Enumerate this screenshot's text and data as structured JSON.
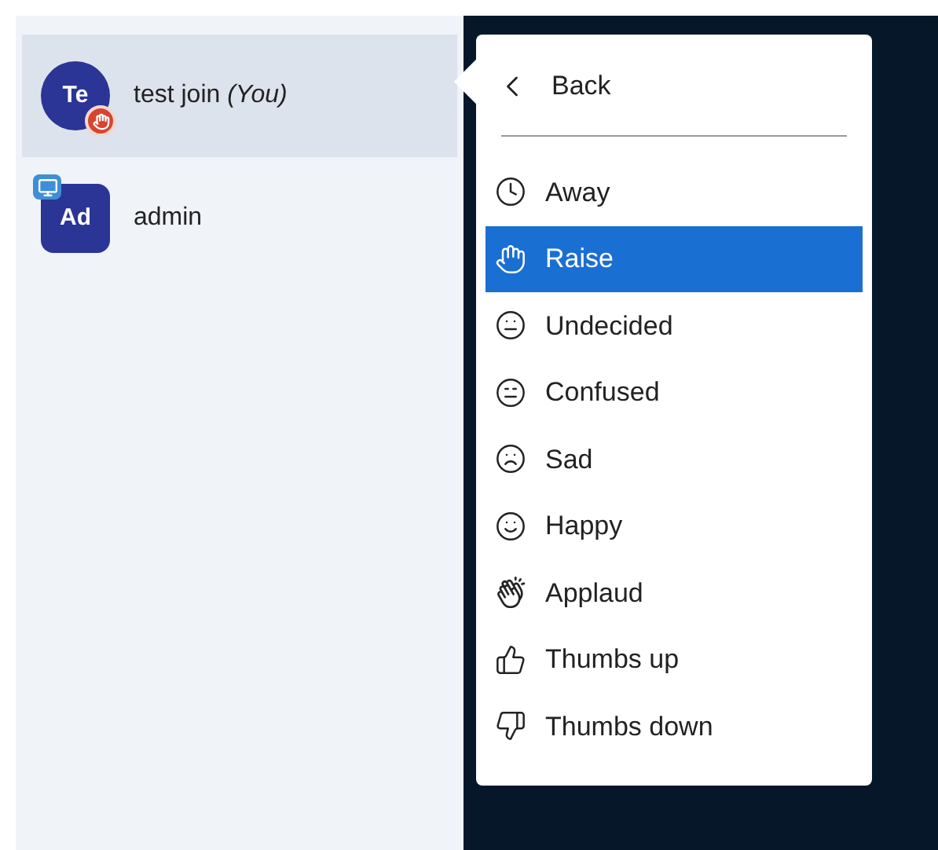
{
  "participants": [
    {
      "initials": "Te",
      "name": "test join",
      "you_label": "(You)",
      "kind": "viewer",
      "selected": true,
      "hand_raised": true,
      "presenter": false
    },
    {
      "initials": "Ad",
      "name": "admin",
      "kind": "moderator",
      "selected": false,
      "hand_raised": false,
      "presenter": true
    }
  ],
  "status_menu": {
    "back_label": "Back",
    "items": [
      {
        "label": "Away",
        "selected": false
      },
      {
        "label": "Raise",
        "selected": true
      },
      {
        "label": "Undecided",
        "selected": false
      },
      {
        "label": "Confused",
        "selected": false
      },
      {
        "label": "Sad",
        "selected": false
      },
      {
        "label": "Happy",
        "selected": false
      },
      {
        "label": "Applaud",
        "selected": false
      },
      {
        "label": "Thumbs up",
        "selected": false
      },
      {
        "label": "Thumbs down",
        "selected": false
      }
    ]
  }
}
